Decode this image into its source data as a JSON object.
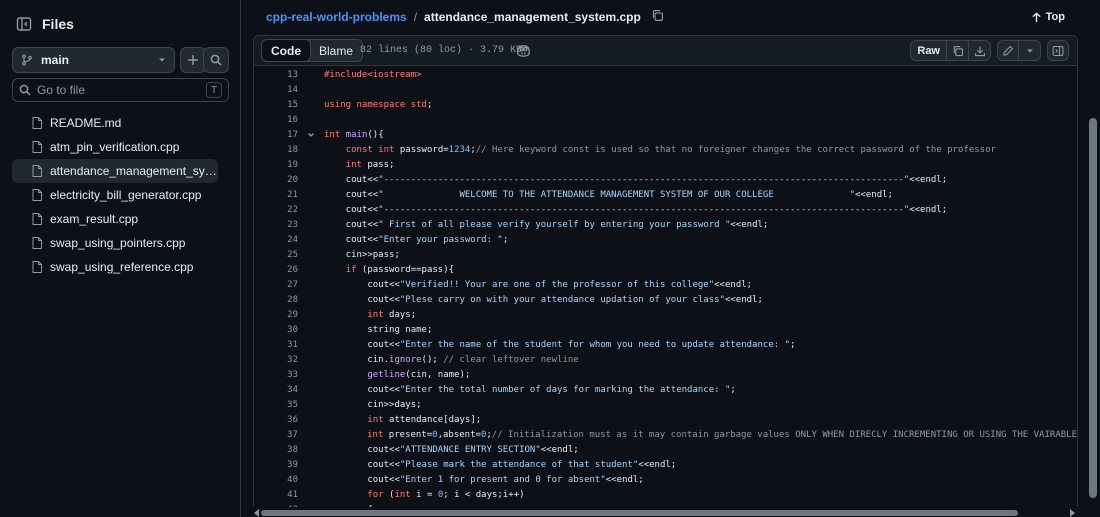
{
  "sidebar": {
    "title": "Files",
    "branch": "main",
    "goto_placeholder": "Go to file",
    "goto_shortcut": "T",
    "files": [
      {
        "name": "README.md"
      },
      {
        "name": "atm_pin_verification.cpp"
      },
      {
        "name": "attendance_management_system...",
        "active": true
      },
      {
        "name": "electricity_bill_generator.cpp"
      },
      {
        "name": "exam_result.cpp"
      },
      {
        "name": "swap_using_pointers.cpp"
      },
      {
        "name": "swap_using_reference.cpp"
      }
    ]
  },
  "breadcrumb": {
    "repo": "cpp-real-world-problems",
    "separator": "/",
    "file": "attendance_management_system.cpp"
  },
  "top_label": "Top",
  "toolbar": {
    "code_tab": "Code",
    "blame_tab": "Blame",
    "meta": "82 lines (80 loc) · 3.79 KB",
    "raw_label": "Raw"
  },
  "code_lines": [
    {
      "n": "13",
      "segs": [
        [
          "pp",
          "#include<iostream>"
        ]
      ]
    },
    {
      "n": "14",
      "segs": []
    },
    {
      "n": "15",
      "segs": [
        [
          "kw",
          "using namespace"
        ],
        [
          "t",
          " "
        ],
        [
          "kw",
          "std"
        ],
        [
          "t",
          ";"
        ]
      ]
    },
    {
      "n": "16",
      "segs": []
    },
    {
      "n": "17",
      "fold": true,
      "segs": [
        [
          "kw",
          "int"
        ],
        [
          "t",
          " "
        ],
        [
          "fn",
          "main"
        ],
        [
          "t",
          "(){"
        ]
      ]
    },
    {
      "n": "18",
      "segs": [
        [
          "t",
          "    "
        ],
        [
          "kw",
          "const int"
        ],
        [
          "t",
          " password="
        ],
        [
          "nu",
          "1234"
        ],
        [
          "t",
          ";"
        ],
        [
          "cm",
          "// Here keyword const is used so that no foreigner changes the correct password of the professor"
        ]
      ]
    },
    {
      "n": "19",
      "segs": [
        [
          "t",
          "    "
        ],
        [
          "kw",
          "int"
        ],
        [
          "t",
          " pass;"
        ]
      ]
    },
    {
      "n": "20",
      "segs": [
        [
          "t",
          "    cout<<"
        ],
        [
          "str",
          "\"------------------------------------------------------------------------------------------------\""
        ],
        [
          "t",
          "<<endl;"
        ]
      ]
    },
    {
      "n": "21",
      "segs": [
        [
          "t",
          "    cout<<"
        ],
        [
          "str",
          "\"              WELCOME TO THE ATTENDANCE MANAGEMENT SYSTEM OF OUR COLLEGE              \""
        ],
        [
          "t",
          "<<endl;"
        ]
      ]
    },
    {
      "n": "22",
      "segs": [
        [
          "t",
          "    cout<<"
        ],
        [
          "str",
          "\"------------------------------------------------------------------------------------------------\""
        ],
        [
          "t",
          "<<endl;"
        ]
      ]
    },
    {
      "n": "23",
      "segs": [
        [
          "t",
          "    cout<<"
        ],
        [
          "str",
          "\" First of all please verify yourself by entering your password \""
        ],
        [
          "t",
          "<<endl;"
        ]
      ]
    },
    {
      "n": "24",
      "segs": [
        [
          "t",
          "    cout<<"
        ],
        [
          "str",
          "\"Enter your password: \""
        ],
        [
          "t",
          ";"
        ]
      ]
    },
    {
      "n": "25",
      "segs": [
        [
          "t",
          "    cin>>pass;"
        ]
      ]
    },
    {
      "n": "26",
      "segs": [
        [
          "t",
          "    "
        ],
        [
          "kw",
          "if"
        ],
        [
          "t",
          " (password==pass){"
        ]
      ]
    },
    {
      "n": "27",
      "segs": [
        [
          "t",
          "        cout<<"
        ],
        [
          "str",
          "\"Verified!! Your are one of the professor of this college\""
        ],
        [
          "t",
          "<<endl;"
        ]
      ]
    },
    {
      "n": "28",
      "segs": [
        [
          "t",
          "        cout<<"
        ],
        [
          "str",
          "\"Plese carry on with your attendance updation of your class\""
        ],
        [
          "t",
          "<<endl;"
        ]
      ]
    },
    {
      "n": "29",
      "segs": [
        [
          "t",
          "        "
        ],
        [
          "kw",
          "int"
        ],
        [
          "t",
          " days;"
        ]
      ]
    },
    {
      "n": "30",
      "segs": [
        [
          "t",
          "        string name;"
        ]
      ]
    },
    {
      "n": "31",
      "segs": [
        [
          "t",
          "        cout<<"
        ],
        [
          "str",
          "\"Enter the name of the student for whom you need to update attendance: \""
        ],
        [
          "t",
          ";"
        ]
      ]
    },
    {
      "n": "32",
      "segs": [
        [
          "t",
          "        cin."
        ],
        [
          "fn",
          "ignore"
        ],
        [
          "t",
          "(); "
        ],
        [
          "cm",
          "// clear leftover newline"
        ]
      ]
    },
    {
      "n": "33",
      "segs": [
        [
          "t",
          "        "
        ],
        [
          "fn",
          "getline"
        ],
        [
          "t",
          "(cin, name);"
        ]
      ]
    },
    {
      "n": "34",
      "segs": [
        [
          "t",
          "        cout<<"
        ],
        [
          "str",
          "\"Enter the total number of days for marking the attendance: \""
        ],
        [
          "t",
          ";"
        ]
      ]
    },
    {
      "n": "35",
      "segs": [
        [
          "t",
          "        cin>>days;"
        ]
      ]
    },
    {
      "n": "36",
      "segs": [
        [
          "t",
          "        "
        ],
        [
          "kw",
          "int"
        ],
        [
          "t",
          " attendance[days];"
        ]
      ]
    },
    {
      "n": "37",
      "segs": [
        [
          "t",
          "        "
        ],
        [
          "kw",
          "int"
        ],
        [
          "t",
          " present="
        ],
        [
          "nu",
          "0"
        ],
        [
          "t",
          ",absent="
        ],
        [
          "nu",
          "0"
        ],
        [
          "t",
          ";"
        ],
        [
          "cm",
          "// Initialization must as it may contain garbage values ONLY WHEN DIRECLY INCREMENTING OR USING THE VAIRABLE"
        ]
      ]
    },
    {
      "n": "38",
      "segs": [
        [
          "t",
          "        cout<<"
        ],
        [
          "str",
          "\"ATTENDANCE ENTRY SECTION\""
        ],
        [
          "t",
          "<<endl;"
        ]
      ]
    },
    {
      "n": "39",
      "segs": [
        [
          "t",
          "        cout<<"
        ],
        [
          "str",
          "\"Please mark the attendance of that student\""
        ],
        [
          "t",
          "<<endl;"
        ]
      ]
    },
    {
      "n": "40",
      "segs": [
        [
          "t",
          "        cout<<"
        ],
        [
          "str",
          "\"Enter 1 for present and 0 for absent\""
        ],
        [
          "t",
          "<<endl;"
        ]
      ]
    },
    {
      "n": "41",
      "segs": [
        [
          "t",
          "        "
        ],
        [
          "kw",
          "for"
        ],
        [
          "t",
          " ("
        ],
        [
          "kw",
          "int"
        ],
        [
          "t",
          " i = "
        ],
        [
          "nu",
          "0"
        ],
        [
          "t",
          "; i < days;i++)"
        ]
      ]
    },
    {
      "n": "42",
      "segs": [
        [
          "t",
          "        {"
        ]
      ]
    }
  ]
}
